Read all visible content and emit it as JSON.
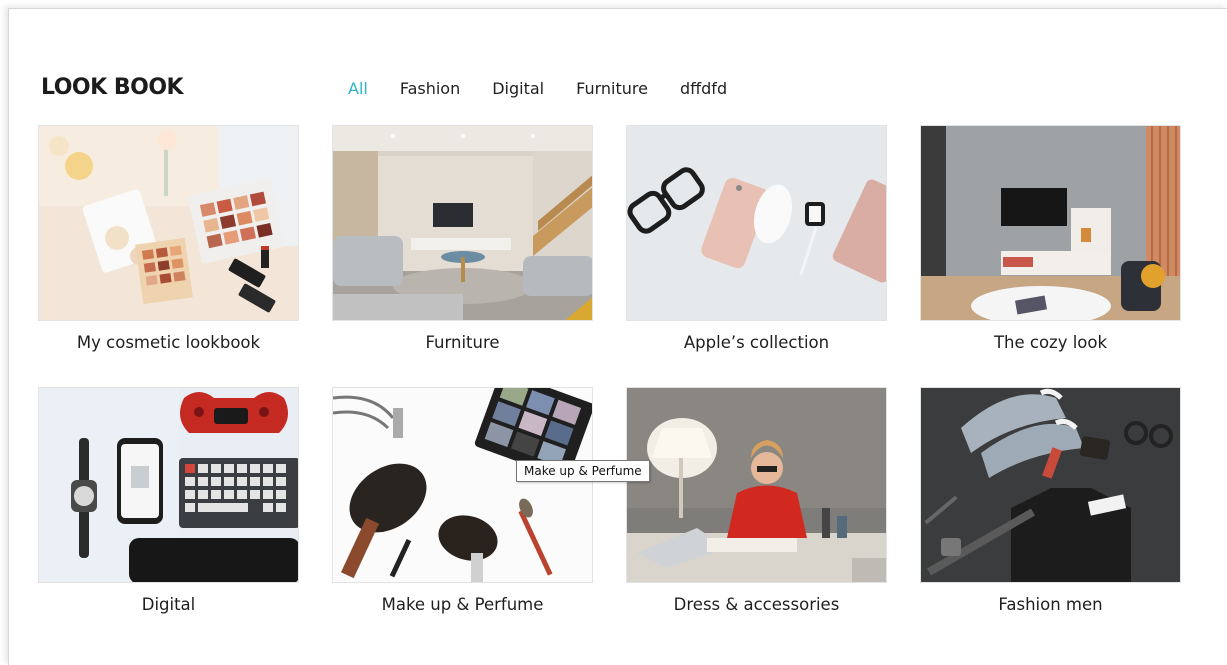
{
  "page": {
    "title": "LOOK BOOK",
    "accent_color": "#2fb1c9"
  },
  "filters": [
    {
      "label": "All",
      "active": true
    },
    {
      "label": "Fashion",
      "active": false
    },
    {
      "label": "Digital",
      "active": false
    },
    {
      "label": "Furniture",
      "active": false
    },
    {
      "label": "dffdfd",
      "active": false
    }
  ],
  "lookbooks": [
    {
      "caption": "My cosmetic lookbook",
      "image": "cosmetics-flatlay-photo"
    },
    {
      "caption": "Furniture",
      "image": "living-room-photo"
    },
    {
      "caption": "Apple’s collection",
      "image": "apple-devices-flatlay-photo"
    },
    {
      "caption": "The cozy look",
      "image": "cozy-living-room-photo"
    },
    {
      "caption": "Digital",
      "image": "digital-gadgets-flatlay-photo"
    },
    {
      "caption": "Make up & Perfume",
      "image": "makeup-brushes-photo"
    },
    {
      "caption": "Dress & accessories",
      "image": "woman-at-desk-photo"
    },
    {
      "caption": "Fashion men",
      "image": "mens-fashion-flatlay-photo"
    }
  ],
  "tooltip": {
    "text": "Make up & Perfume"
  }
}
